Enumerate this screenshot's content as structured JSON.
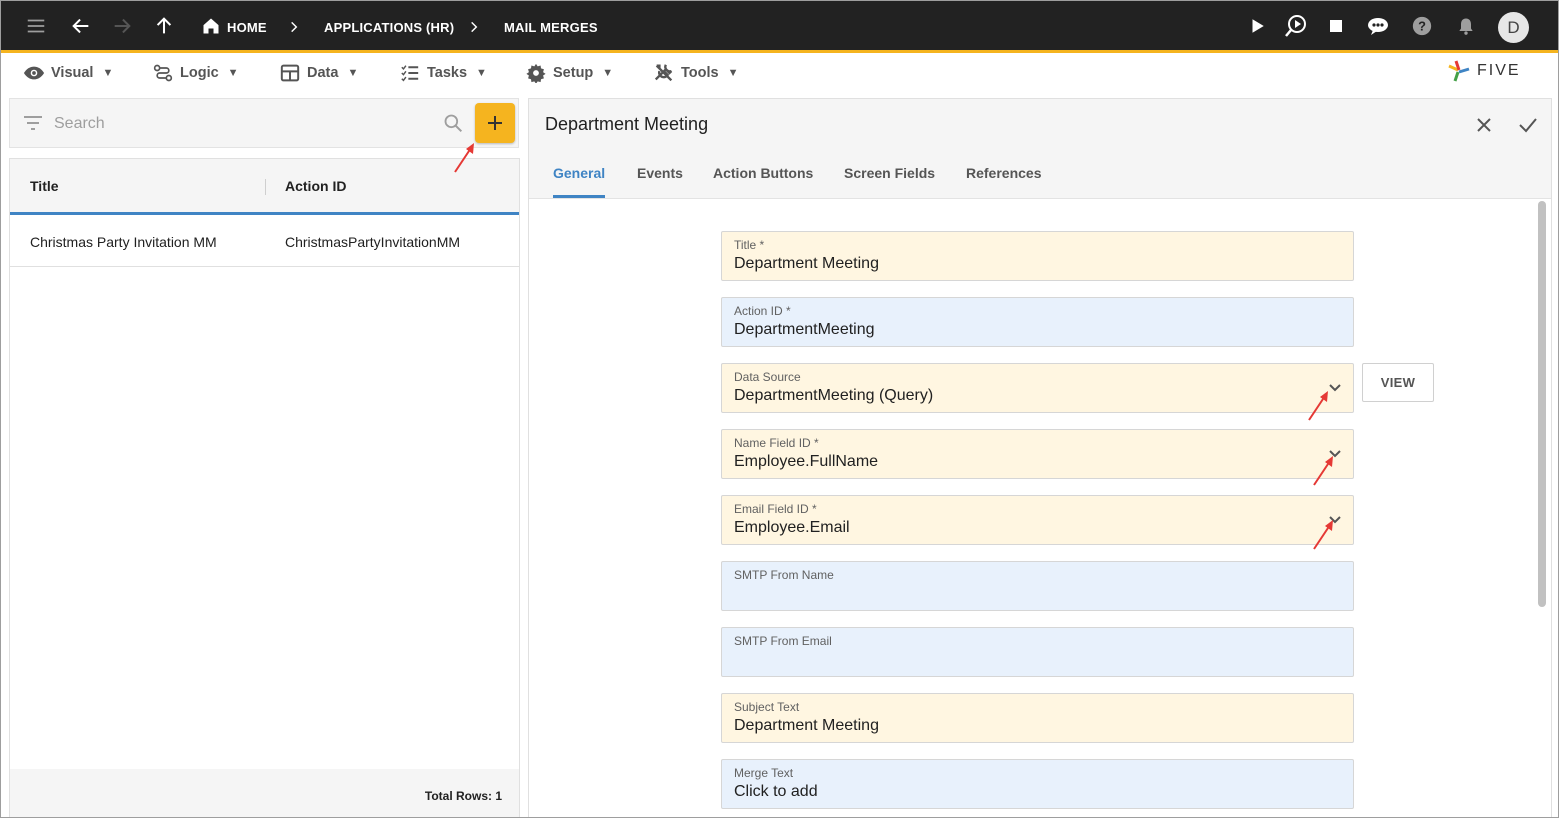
{
  "topbar": {
    "breadcrumbs": [
      "HOME",
      "APPLICATIONS (HR)",
      "MAIL MERGES"
    ],
    "avatar_initial": "D",
    "accent": "#f5b41f"
  },
  "menubar": {
    "items": [
      {
        "label": "Visual",
        "icon": "eye-icon"
      },
      {
        "label": "Logic",
        "icon": "logic-flow-icon"
      },
      {
        "label": "Data",
        "icon": "table-icon"
      },
      {
        "label": "Tasks",
        "icon": "checklist-icon"
      },
      {
        "label": "Setup",
        "icon": "gear-icon"
      },
      {
        "label": "Tools",
        "icon": "wrench-icon"
      }
    ],
    "caret": "▼",
    "logo_text": "FIVE"
  },
  "list": {
    "search_placeholder": "Search",
    "columns": [
      "Title",
      "Action ID"
    ],
    "rows": [
      {
        "title": "Christmas Party Invitation MM",
        "action_id": "ChristmasPartyInvitationMM"
      }
    ],
    "total_rows": "Total Rows: 1"
  },
  "form": {
    "title": "Department Meeting",
    "tabs": [
      "General",
      "Events",
      "Action Buttons",
      "Screen Fields",
      "References"
    ],
    "view_label": "VIEW",
    "fields": [
      {
        "label": "Title *",
        "value": "Department Meeting"
      },
      {
        "label": "Action ID *",
        "value": "DepartmentMeeting"
      },
      {
        "label": "Data Source",
        "value": "DepartmentMeeting (Query)"
      },
      {
        "label": "Name Field ID *",
        "value": "Employee.FullName"
      },
      {
        "label": "Email Field ID *",
        "value": "Employee.Email"
      },
      {
        "label": "SMTP From Name",
        "value": ""
      },
      {
        "label": "SMTP From Email",
        "value": ""
      },
      {
        "label": "Subject Text",
        "value": "Department Meeting"
      },
      {
        "label": "Merge Text",
        "value": "Click to add"
      }
    ]
  },
  "colors": {
    "required_field_bg": "#fff6e1",
    "optional_field_bg": "#e8f1fc",
    "active_tab": "#3f84c4",
    "annotation_arrow": "#e53935"
  }
}
